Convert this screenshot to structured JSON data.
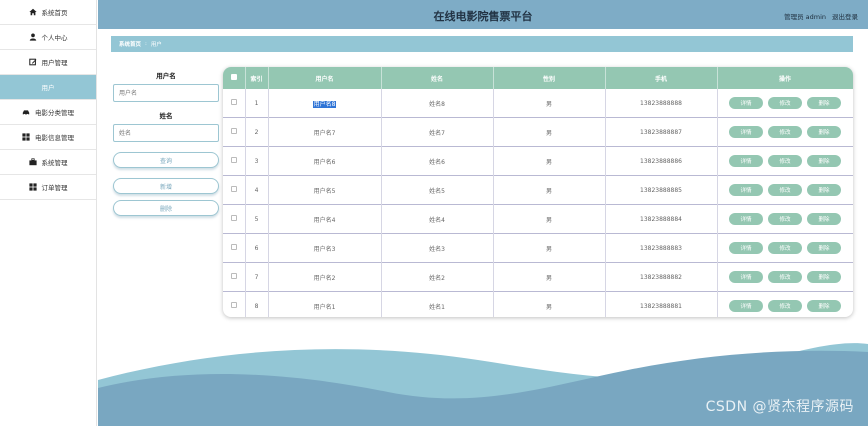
{
  "header": {
    "title": "在线电影院售票平台",
    "user_label": "管理员 admin",
    "logout_label": "退出登录"
  },
  "sidebar": {
    "items": [
      {
        "label": "系统首页",
        "icon": "home-icon"
      },
      {
        "label": "个人中心",
        "icon": "person-icon"
      },
      {
        "label": "用户管理",
        "icon": "edit-icon"
      },
      {
        "label": "用户",
        "icon": "",
        "active": true
      },
      {
        "label": "电影分类管理",
        "icon": "car-icon"
      },
      {
        "label": "电影信息管理",
        "icon": "grid-icon"
      },
      {
        "label": "系统管理",
        "icon": "briefcase-icon"
      },
      {
        "label": "订单管理",
        "icon": "grid-icon"
      }
    ]
  },
  "breadcrumb": {
    "home": "系统首页",
    "separator": ":",
    "current": "用户"
  },
  "search": {
    "username_label": "用户名",
    "username_placeholder": "用户名",
    "name_label": "姓名",
    "name_placeholder": "姓名",
    "query_label": "查询",
    "add_label": "新增",
    "delete_label": "删除"
  },
  "table": {
    "headers": [
      "索引",
      "用户名",
      "姓名",
      "性别",
      "手机",
      "操作"
    ],
    "actions": {
      "detail": "详情",
      "edit": "修改",
      "delete": "删除"
    },
    "rows": [
      {
        "index": "1",
        "username": "用户名8",
        "name": "姓名8",
        "gender": "男",
        "phone": "13823888888"
      },
      {
        "index": "2",
        "username": "用户名7",
        "name": "姓名7",
        "gender": "男",
        "phone": "13823888887"
      },
      {
        "index": "3",
        "username": "用户名6",
        "name": "姓名6",
        "gender": "男",
        "phone": "13823888886"
      },
      {
        "index": "4",
        "username": "用户名5",
        "name": "姓名5",
        "gender": "男",
        "phone": "13823888885"
      },
      {
        "index": "5",
        "username": "用户名4",
        "name": "姓名4",
        "gender": "男",
        "phone": "13823888884"
      },
      {
        "index": "6",
        "username": "用户名3",
        "name": "姓名3",
        "gender": "男",
        "phone": "13823888883"
      },
      {
        "index": "7",
        "username": "用户名2",
        "name": "姓名2",
        "gender": "男",
        "phone": "13823888882"
      },
      {
        "index": "8",
        "username": "用户名1",
        "name": "姓名1",
        "gender": "男",
        "phone": "13823888881"
      }
    ]
  },
  "watermark": "CSDN @贤杰程序源码",
  "colors": {
    "header_bg": "#7eacc6",
    "accent_blue": "#93c6d5",
    "accent_green": "#94c7b2",
    "wave_dark": "#79a7c1",
    "wave_light": "#93c6d5"
  }
}
